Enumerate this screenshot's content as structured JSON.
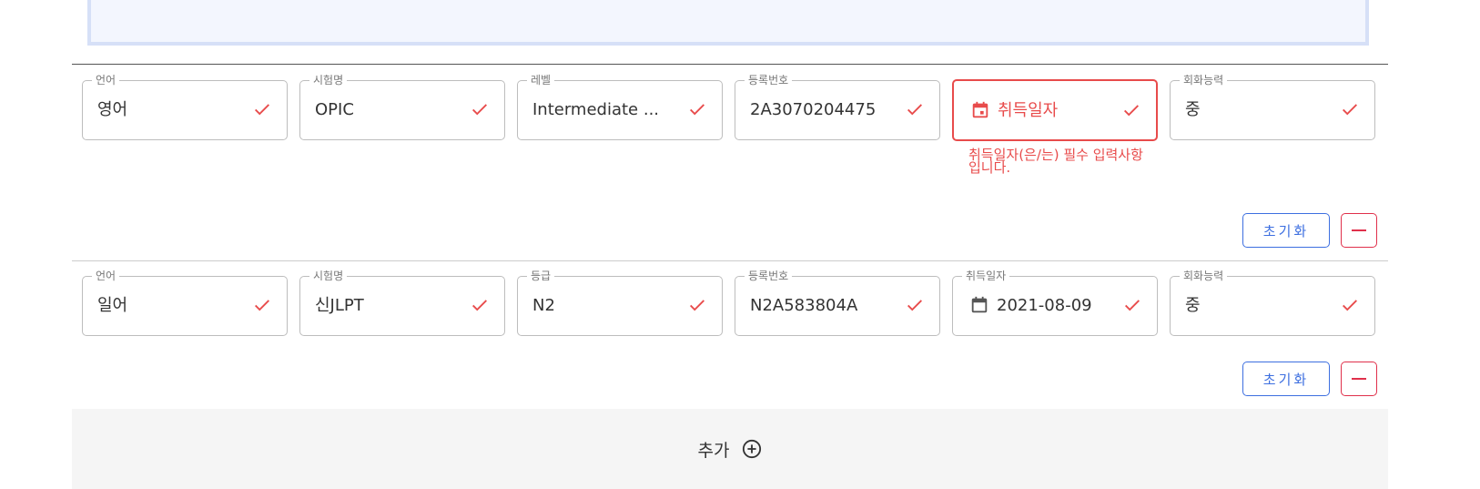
{
  "rows": [
    {
      "fields": [
        {
          "label": "언어",
          "value": "영어"
        },
        {
          "label": "시험명",
          "value": "OPIC"
        },
        {
          "label": "레벨",
          "value": "Intermediate ..."
        },
        {
          "label": "등록번호",
          "value": "2A3070204475"
        },
        {
          "label": "",
          "value": "취득일자",
          "state": "error"
        },
        {
          "label": "회화능력",
          "value": "중"
        }
      ],
      "error_message": "취득일자(은/는) 필수 입력사항입니다.",
      "reset_label": "초기화"
    },
    {
      "fields": [
        {
          "label": "언어",
          "value": "일어"
        },
        {
          "label": "시험명",
          "value": "신JLPT"
        },
        {
          "label": "등급",
          "value": "N2"
        },
        {
          "label": "등록번호",
          "value": "N2A583804A"
        },
        {
          "label": "취득일자",
          "value": "2021-08-09"
        },
        {
          "label": "회화능력",
          "value": "중"
        }
      ],
      "reset_label": "초기화"
    }
  ],
  "add_label": "추가",
  "icons": {
    "check": "check-icon",
    "calendar": "calendar-icon",
    "plus": "circle-plus-icon",
    "minus": "minus-icon"
  },
  "colors": {
    "check": "#e84b4b",
    "error": "#e84b4b",
    "primary": "#3d6fe0",
    "danger": "#e0304b"
  }
}
